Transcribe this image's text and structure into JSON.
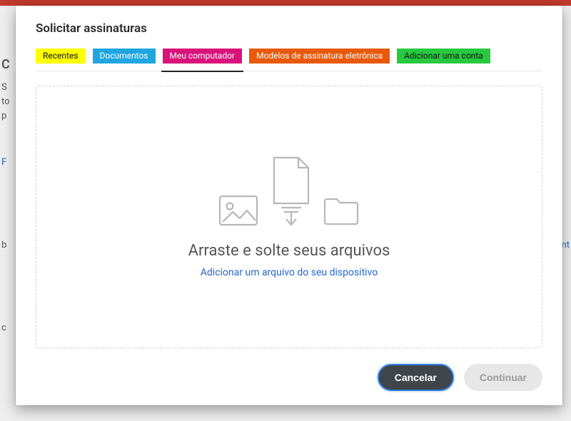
{
  "background": {
    "fragments": [
      "C",
      "S",
      "to",
      "p",
      "F",
      "b",
      "nt",
      "c"
    ]
  },
  "modal": {
    "title": "Solicitar assinaturas",
    "tabs": [
      {
        "label": "Recentes"
      },
      {
        "label": "Documentos"
      },
      {
        "label": "Meu computador"
      },
      {
        "label": "Modelos de assinatura eletrônica"
      },
      {
        "label": "Adicionar uma conta"
      }
    ],
    "dropzone": {
      "headline": "Arraste e solte seus arquivos",
      "link": "Adicionar um arquivo do seu dispositivo"
    },
    "buttons": {
      "cancel": "Cancelar",
      "continue": "Continuar"
    }
  }
}
